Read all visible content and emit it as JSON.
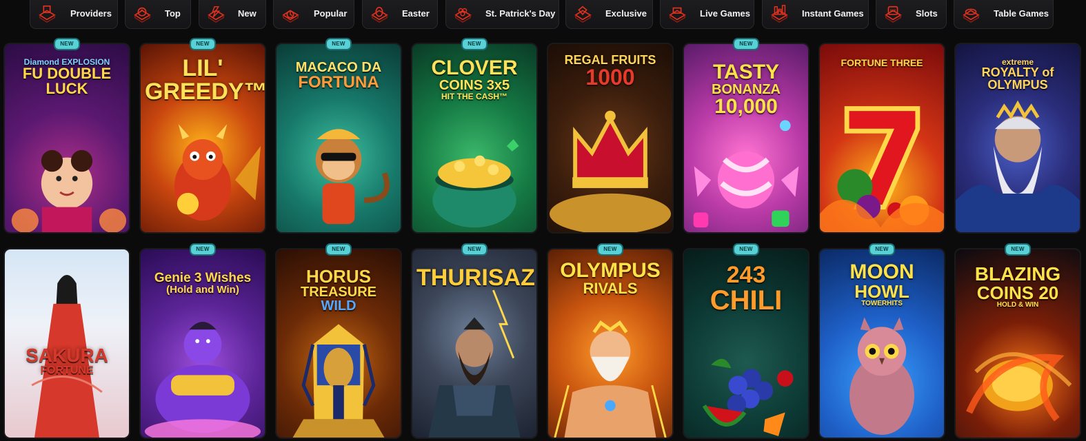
{
  "nav": {
    "items": [
      {
        "label": "Providers",
        "icon": "providers-icon"
      },
      {
        "label": "Top",
        "icon": "top-icon"
      },
      {
        "label": "New",
        "icon": "new-icon"
      },
      {
        "label": "Popular",
        "icon": "popular-icon"
      },
      {
        "label": "Easter",
        "icon": "easter-icon"
      },
      {
        "label": "St. Patrick's Day",
        "icon": "st-patricks-icon"
      },
      {
        "label": "Exclusive",
        "icon": "exclusive-icon"
      },
      {
        "label": "Live Games",
        "icon": "live-games-icon"
      },
      {
        "label": "Instant Games",
        "icon": "instant-games-icon"
      },
      {
        "label": "Slots",
        "icon": "slots-icon"
      },
      {
        "label": "Table Games",
        "icon": "table-games-icon"
      }
    ]
  },
  "badge_label": "NEW",
  "games": [
    {
      "lines": [
        "Diamond EXPLOSION",
        "FU DOUBLE",
        "LUCK"
      ],
      "is_new": true
    },
    {
      "lines": [
        "LIL'",
        "GREEDY™"
      ],
      "is_new": true
    },
    {
      "lines": [
        "MACACO DA",
        "FORTUNA"
      ],
      "is_new": true
    },
    {
      "lines": [
        "CLOVER",
        "COINS 3x5",
        "HIT THE CASH™"
      ],
      "is_new": true
    },
    {
      "lines": [
        "REGAL FRUITS",
        "1000"
      ],
      "is_new": false
    },
    {
      "lines": [
        "TASTY",
        "BONANZA",
        "10,000"
      ],
      "is_new": true
    },
    {
      "lines": [
        "FORTUNE THREE"
      ],
      "is_new": false
    },
    {
      "lines": [
        "extreme",
        "ROYALTY of OLYMPUS"
      ],
      "is_new": false
    },
    {
      "lines": [
        "SAKURA",
        "FORTUNE"
      ],
      "is_new": false
    },
    {
      "lines": [
        "Genie 3 Wishes",
        "(Hold and Win)"
      ],
      "is_new": true
    },
    {
      "lines": [
        "HORUS",
        "TREASURE",
        "WILD"
      ],
      "is_new": true
    },
    {
      "lines": [
        "THURISAZ"
      ],
      "is_new": true
    },
    {
      "lines": [
        "OLYMPUS",
        "RIVALS"
      ],
      "is_new": true
    },
    {
      "lines": [
        "243",
        "CHILI"
      ],
      "is_new": true
    },
    {
      "lines": [
        "MOON",
        "HOWL",
        "TOWERHITS"
      ],
      "is_new": true
    },
    {
      "lines": [
        "BLAZING",
        "COINS 20",
        "HOLD & WIN"
      ],
      "is_new": true
    }
  ],
  "colors": {
    "background": "#0b0b0c",
    "nav_icon": "#e0311f",
    "badge": "#57d0d6"
  }
}
